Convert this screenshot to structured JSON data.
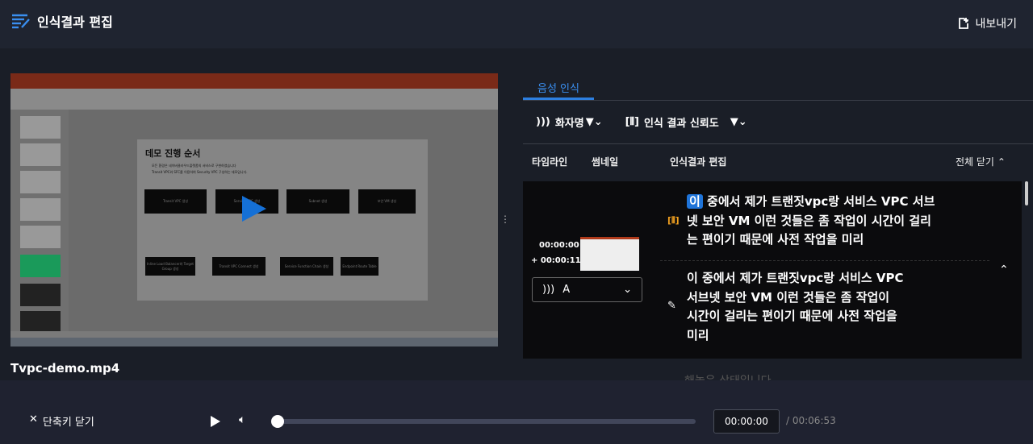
{
  "header": {
    "title": "인식결과 편집",
    "export_label": "내보내기"
  },
  "video": {
    "filename": "Tvpc-demo.mp4",
    "slide_title": "데모 진행 순서",
    "slide_bullets": [
      "모든 환경은 네이버클라우드플랫폼의 서비스로 구현하였습니다",
      "Transit VPC와 SFC를 이용하여 Security VPC 구성하는 데모입니다."
    ],
    "steps": [
      "Transit VPC 생성",
      "Service VPC 생성",
      "Subnet 생성",
      "보안 VM 생성",
      "Inline Load Balancer와 Target Group 생성",
      "Transit VPC Connect 생성",
      "Service Function Chain 생성",
      "Endpoint Route Table"
    ]
  },
  "panel": {
    "tab": "음성 인식",
    "filters": {
      "speaker": "화자명",
      "confidence": "인식 결과 신뢰도"
    },
    "columns": {
      "timeline": "타임라인",
      "thumbnail": "썸네일",
      "edit": "인식결과 편집",
      "collapse_all": "전체 닫기"
    },
    "segment": {
      "start": "00:00:00",
      "duration": "+ 00:00:11",
      "speaker": "A",
      "highlight_word": "이",
      "recognized_lines": [
        " 중에서 제가 트랜짓vpc랑 서비스 VPC 서브",
        "넷 보안 VM 이런 것들은 좀 작업이 시간이 걸리",
        "는 편이기 때문에 사전 작업을 미리"
      ],
      "edited_lines": [
        "이 중에서 제가 트랜짓vpc랑 서비스 VPC",
        "서브넷 보안 VM 이런 것들은 좀 작업이",
        "시간이 걸리는 편이기 때문에 사전 작업을",
        "미리"
      ]
    },
    "next_text": "해놓은 상태입니다"
  },
  "player": {
    "close_shortcuts": "단축키 닫기",
    "current_time": "00:00:00",
    "duration": "/ 00:06:53",
    "progress": 0
  },
  "colors": {
    "accent": "#2d7fe0",
    "confidence_icon": "#f0a020"
  }
}
